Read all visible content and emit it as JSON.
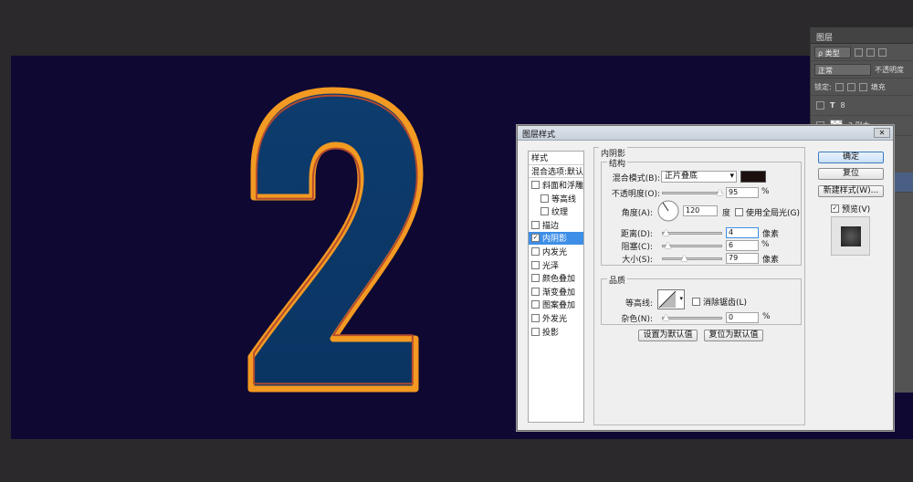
{
  "canvas": {
    "background": "#0f0833",
    "digit": "2",
    "digit_fill": "#0e3a6b",
    "outline_color": "#f39a22"
  },
  "layers_panel": {
    "tab": "图层",
    "filter_label": "ρ 类型",
    "blend_mode": "正常",
    "opacity_label": "不透明度",
    "lock_label": "锁定:",
    "fill_label": "填充",
    "layers": [
      {
        "type": "text",
        "name": "8"
      },
      {
        "type": "image",
        "name": "2 副本"
      }
    ]
  },
  "dialog": {
    "title": "图层样式",
    "close": "✕",
    "styles_list": [
      {
        "label": "样式",
        "level": "header",
        "checked": null,
        "active": false
      },
      {
        "label": "混合选项:默认",
        "level": "header",
        "checked": null,
        "active": false
      },
      {
        "label": "斜面和浮雕",
        "level": "top",
        "checked": false,
        "active": false
      },
      {
        "label": "等高线",
        "level": "sub",
        "checked": false,
        "active": false
      },
      {
        "label": "纹理",
        "level": "sub",
        "checked": false,
        "active": false
      },
      {
        "label": "描边",
        "level": "top",
        "checked": false,
        "active": false
      },
      {
        "label": "内阴影",
        "level": "top",
        "checked": true,
        "active": true
      },
      {
        "label": "内发光",
        "level": "top",
        "checked": false,
        "active": false
      },
      {
        "label": "光泽",
        "level": "top",
        "checked": false,
        "active": false
      },
      {
        "label": "颜色叠加",
        "level": "top",
        "checked": false,
        "active": false
      },
      {
        "label": "渐变叠加",
        "level": "top",
        "checked": false,
        "active": false
      },
      {
        "label": "图案叠加",
        "level": "top",
        "checked": false,
        "active": false
      },
      {
        "label": "外发光",
        "level": "top",
        "checked": false,
        "active": false
      },
      {
        "label": "投影",
        "level": "top",
        "checked": false,
        "active": false
      }
    ],
    "inner_shadow": {
      "section_title": "内阴影",
      "structure_title": "结构",
      "blend_mode_label": "混合模式(B):",
      "blend_mode_value": "正片叠底",
      "shadow_color": "#1c0f0d",
      "opacity_label": "不透明度(O):",
      "opacity_value": "95",
      "opacity_unit": "%",
      "angle_label": "角度(A):",
      "angle_value": "120",
      "angle_unit": "度",
      "global_light_label": "使用全局光(G)",
      "global_light_checked": false,
      "distance_label": "距离(D):",
      "distance_value": "4",
      "distance_unit": "像素",
      "choke_label": "阻塞(C):",
      "choke_value": "6",
      "choke_unit": "%",
      "size_label": "大小(S):",
      "size_value": "79",
      "size_unit": "像素",
      "quality_title": "品质",
      "contour_label": "等高线:",
      "anti_alias_label": "消除锯齿(L)",
      "anti_alias_checked": false,
      "noise_label": "杂色(N):",
      "noise_value": "0",
      "noise_unit": "%",
      "set_default_label": "设置为默认值",
      "reset_default_label": "复位为默认值"
    },
    "buttons": {
      "ok": "确定",
      "reset": "复位",
      "new_style": "新建样式(W)...",
      "preview_label": "预览(V)",
      "preview_checked": true
    }
  }
}
